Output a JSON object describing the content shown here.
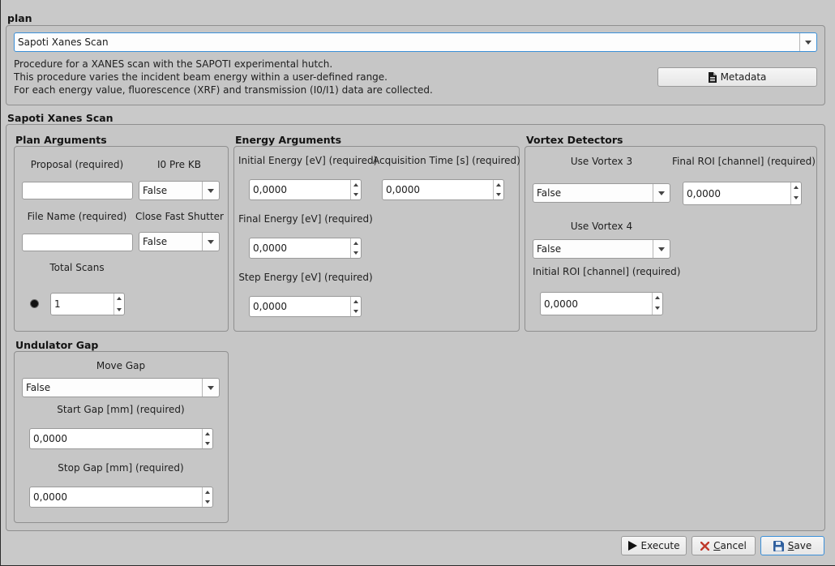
{
  "plan": {
    "group_title": "plan",
    "selected_plan": "Sapoti Xanes Scan",
    "description": [
      "Procedure for a XANES scan with the SAPOTI experimental hutch.",
      "This procedure varies the incident beam energy within a user-defined range.",
      "For each energy value, fluorescence (XRF) and transmission (I0/I1) data are collected."
    ],
    "metadata_button": "Metadata"
  },
  "scan": {
    "group_title": "Sapoti Xanes Scan",
    "plan_arguments": {
      "title": "Plan Arguments",
      "proposal_label": "Proposal (required)",
      "proposal_value": "",
      "i0_pre_kb_label": "I0 Pre KB",
      "i0_pre_kb_value": "False",
      "file_name_label": "File Name (required)",
      "file_name_value": "",
      "close_fast_shutter_label": "Close Fast Shutter",
      "close_fast_shutter_value": "False",
      "total_scans_label": "Total Scans",
      "total_scans_value": "1"
    },
    "energy_arguments": {
      "title": "Energy Arguments",
      "initial_energy_label": "Initial Energy [eV] (required)",
      "initial_energy_value": "0,0000",
      "acquisition_time_label": "Acquisition Time [s] (required)",
      "acquisition_time_value": "0,0000",
      "final_energy_label": "Final Energy [eV] (required)",
      "final_energy_value": "0,0000",
      "step_energy_label": "Step Energy [eV] (required)",
      "step_energy_value": "0,0000"
    },
    "vortex_detectors": {
      "title": "Vortex Detectors",
      "use_vortex3_label": "Use Vortex 3",
      "use_vortex3_value": "False",
      "final_roi_label": "Final ROI [channel] (required)",
      "final_roi_value": "0,0000",
      "use_vortex4_label": "Use Vortex 4",
      "use_vortex4_value": "False",
      "initial_roi_label": "Initial ROI [channel] (required)",
      "initial_roi_value": "0,0000"
    },
    "undulator_gap": {
      "title": "Undulator Gap",
      "move_gap_label": "Move Gap",
      "move_gap_value": "False",
      "start_gap_label": "Start Gap [mm] (required)",
      "start_gap_value": "0,0000",
      "stop_gap_label": "Stop Gap [mm] (required)",
      "stop_gap_value": "0,0000"
    }
  },
  "footer": {
    "execute": "Execute",
    "cancel_first": "C",
    "cancel_rest": "ancel",
    "save_first": "S",
    "save_rest": "ave"
  },
  "colors": {
    "background": "#c9c9c9",
    "focus_border": "#3a8fd8",
    "cancel_icon": "#c0392b",
    "save_icon": "#2f5f9e"
  }
}
